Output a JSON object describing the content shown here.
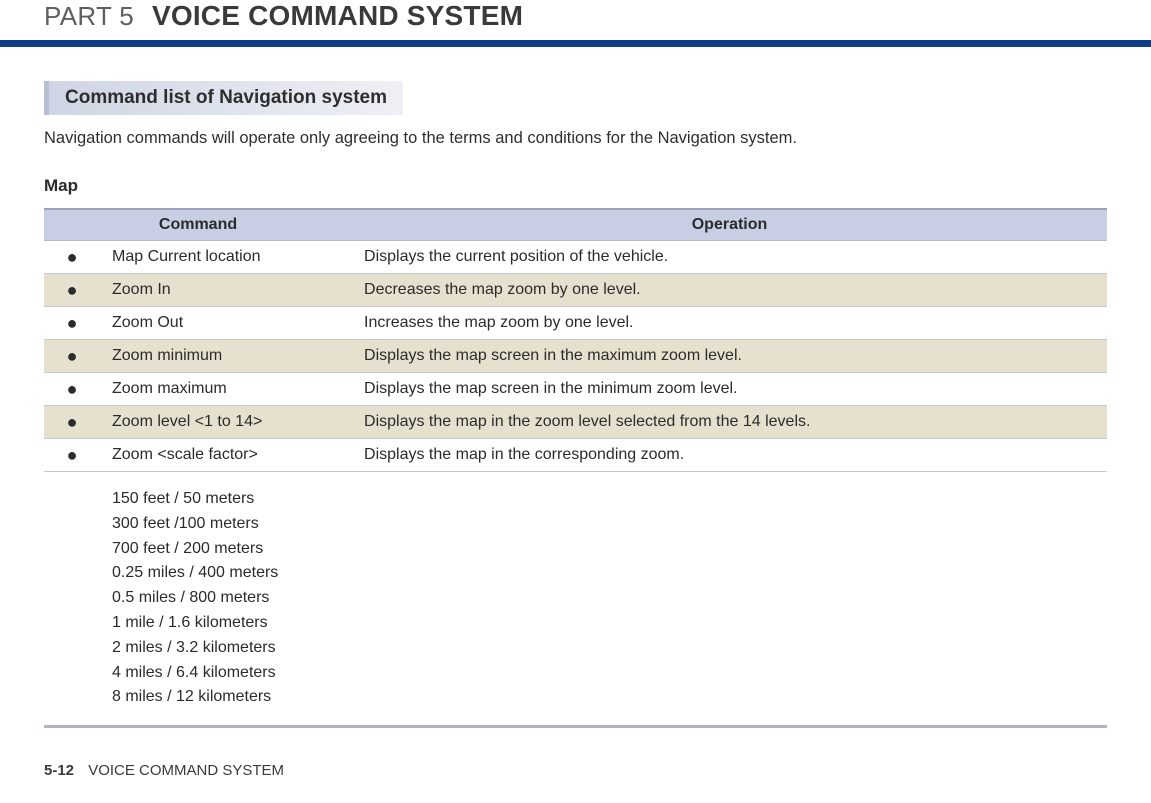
{
  "header": {
    "part_label": "PART 5",
    "part_title": "VOICE COMMAND SYSTEM"
  },
  "section": {
    "title": "Command list of Navigation system",
    "note": "Navigation commands will operate only agreeing to the terms and  conditions for the Navigation system."
  },
  "subheading": "Map",
  "table": {
    "headers": {
      "command": "Command",
      "operation": "Operation"
    },
    "rows": [
      {
        "bullet": "●",
        "command": "Map Current location",
        "operation": "Displays the current position of the vehicle.",
        "alt": false
      },
      {
        "bullet": "●",
        "command": "Zoom In",
        "operation": "Decreases the map zoom by one level.",
        "alt": true
      },
      {
        "bullet": "●",
        "command": "Zoom Out",
        "operation": "Increases the map zoom by one level.",
        "alt": false
      },
      {
        "bullet": "●",
        "command": "Zoom minimum",
        "operation": "Displays the map screen in the maximum zoom level.",
        "alt": true
      },
      {
        "bullet": "●",
        "command": "Zoom maximum",
        "operation": "Displays the map screen in the minimum zoom level.",
        "alt": false
      },
      {
        "bullet": "●",
        "command": "Zoom level <1 to 14>",
        "operation": "Displays the map in the zoom level selected from the 14 levels.",
        "alt": true
      },
      {
        "bullet": "●",
        "command": "Zoom <scale factor>",
        "operation": "Displays the map in the corresponding zoom.",
        "alt": false
      }
    ],
    "scale_row": {
      "lines": "150 feet / 50 meters\n300 feet /100 meters\n700 feet / 200 meters\n0.25 miles / 400 meters\n0.5 miles / 800 meters\n1 mile / 1.6 kilometers\n2 miles / 3.2 kilometers\n4 miles / 6.4 kilometers\n8 miles / 12 kilometers"
    }
  },
  "footer": {
    "page_number": "5-12",
    "label": "VOICE COMMAND SYSTEM"
  }
}
